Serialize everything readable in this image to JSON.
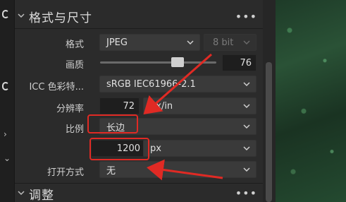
{
  "section_format": {
    "title": "格式与尺寸",
    "more": "•••",
    "rows": {
      "format": {
        "label": "格式",
        "value": "JPEG",
        "bit_depth": "8 bit"
      },
      "quality": {
        "label": "画质",
        "value": "76",
        "level_percent": 76
      },
      "icc": {
        "label": "ICC 色彩特...",
        "value": "sRGB IEC61966-2.1"
      },
      "resolution": {
        "label": "分辨率",
        "value": "72",
        "unit": "px/in"
      },
      "scale": {
        "label": "比例",
        "value": "长边"
      },
      "size": {
        "value": "1200",
        "unit": "px"
      },
      "open_with": {
        "label": "打开方式",
        "value": "无"
      }
    }
  },
  "section_adjust": {
    "title": "调整",
    "more": "•••"
  },
  "colors": {
    "annotation_red": "#e02a24",
    "panel_bg": "#2b2b2b",
    "field_bg": "#3a3a3a"
  }
}
